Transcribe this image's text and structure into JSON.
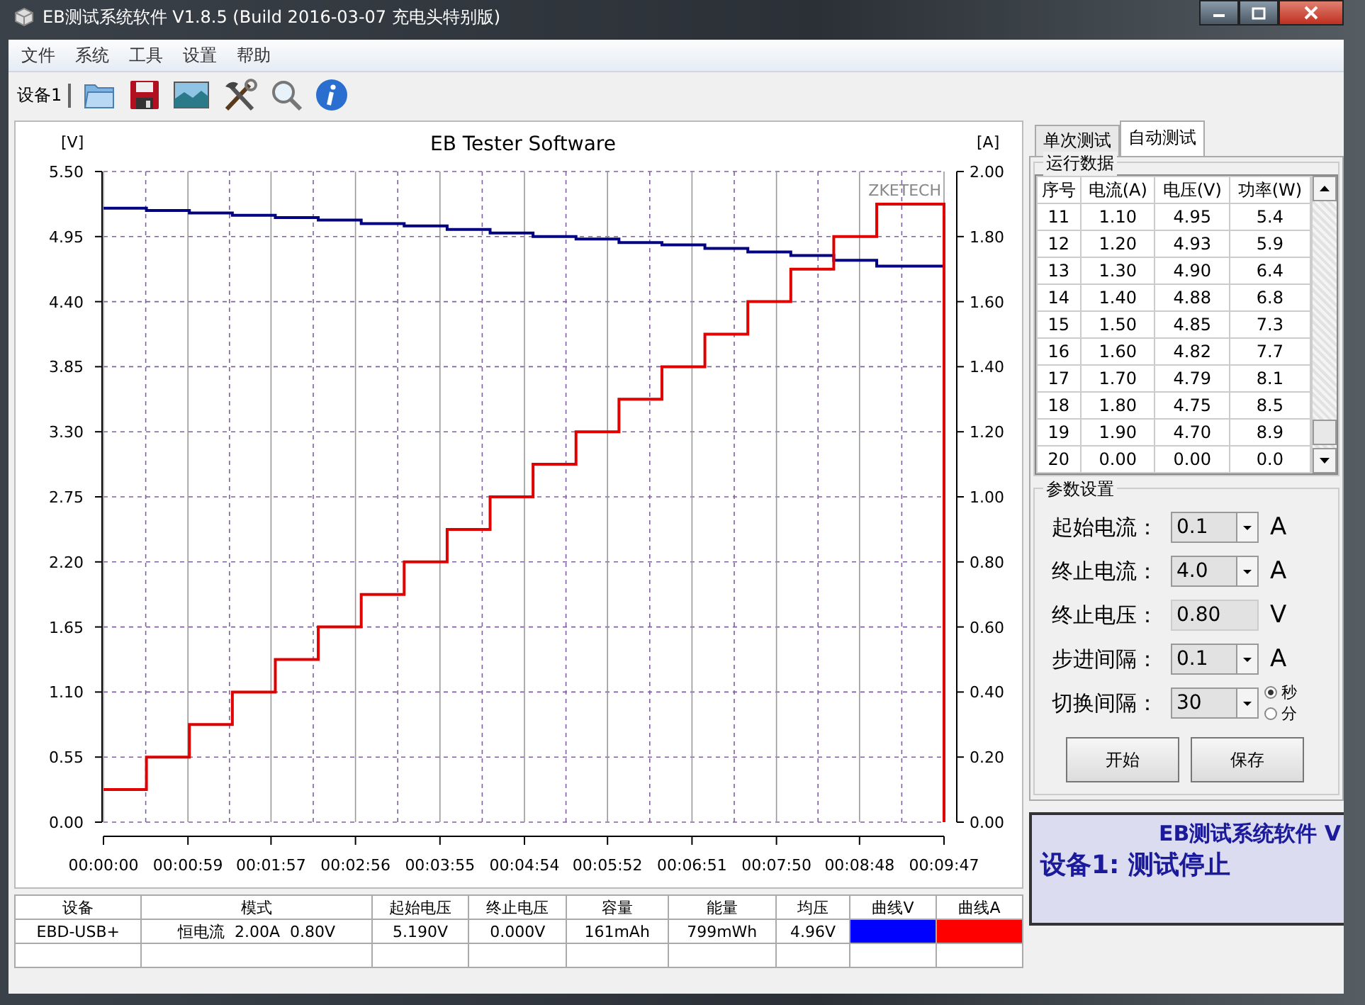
{
  "window": {
    "title": "EB测试系统软件 V1.8.5 (Build 2016-03-07 充电头特别版)"
  },
  "menu": [
    "文件",
    "系统",
    "工具",
    "设置",
    "帮助"
  ],
  "toolbar": {
    "device_tab": "设备1"
  },
  "chart": {
    "brand": "ZKETECH",
    "chart_data": {
      "type": "line",
      "title": "EB Tester Software",
      "ylabel": "[V]",
      "y2label": "[A]",
      "grid": true,
      "x": [
        0,
        30,
        30,
        60,
        60,
        90,
        90,
        120,
        120,
        150,
        150,
        180,
        180,
        210,
        210,
        240,
        240,
        270,
        270,
        300,
        300,
        330,
        330,
        360,
        360,
        390,
        390,
        420,
        420,
        450,
        450,
        480,
        480,
        510,
        510,
        540,
        540,
        587,
        587
      ],
      "series": [
        {
          "color": "#000080",
          "axis": "y",
          "values": [
            5.19,
            5.19,
            5.17,
            5.17,
            5.15,
            5.15,
            5.13,
            5.13,
            5.11,
            5.11,
            5.09,
            5.09,
            5.06,
            5.06,
            5.04,
            5.04,
            5.01,
            5.01,
            4.98,
            4.98,
            4.95,
            4.95,
            4.93,
            4.93,
            4.9,
            4.9,
            4.88,
            4.88,
            4.85,
            4.85,
            4.82,
            4.82,
            4.79,
            4.79,
            4.75,
            4.75,
            4.7,
            4.7,
            4.7
          ]
        },
        {
          "color": "#e00000",
          "axis": "y2",
          "values": [
            0.1,
            0.1,
            0.2,
            0.2,
            0.3,
            0.3,
            0.4,
            0.4,
            0.5,
            0.5,
            0.6,
            0.6,
            0.7,
            0.7,
            0.8,
            0.8,
            0.9,
            0.9,
            1.0,
            1.0,
            1.1,
            1.1,
            1.2,
            1.2,
            1.3,
            1.3,
            1.4,
            1.4,
            1.5,
            1.5,
            1.6,
            1.6,
            1.7,
            1.7,
            1.8,
            1.8,
            1.9,
            1.9,
            0
          ]
        }
      ],
      "xlim": [
        0,
        587
      ],
      "ylim": [
        0,
        5.5
      ],
      "y2lim": [
        0,
        2
      ],
      "xticks": [
        {
          "value": 0,
          "label": "00:00:00"
        },
        {
          "value": 59,
          "label": "00:00:59"
        },
        {
          "value": 117,
          "label": "00:01:57"
        },
        {
          "value": 176,
          "label": "00:02:56"
        },
        {
          "value": 235,
          "label": "00:03:55"
        },
        {
          "value": 294,
          "label": "00:04:54"
        },
        {
          "value": 352,
          "label": "00:05:52"
        },
        {
          "value": 411,
          "label": "00:06:51"
        },
        {
          "value": 470,
          "label": "00:07:50"
        },
        {
          "value": 528,
          "label": "00:08:48"
        },
        {
          "value": 587,
          "label": "00:09:47"
        }
      ],
      "yticks": [
        {
          "value": 0,
          "label": "0.00"
        },
        {
          "value": 0.55,
          "label": "0.55"
        },
        {
          "value": 1.1,
          "label": "1.10"
        },
        {
          "value": 1.65,
          "label": "1.65"
        },
        {
          "value": 2.2,
          "label": "2.20"
        },
        {
          "value": 2.75,
          "label": "2.75"
        },
        {
          "value": 3.3,
          "label": "3.30"
        },
        {
          "value": 3.85,
          "label": "3.85"
        },
        {
          "value": 4.4,
          "label": "4.40"
        },
        {
          "value": 4.95,
          "label": "4.95"
        },
        {
          "value": 5.5,
          "label": "5.50"
        }
      ],
      "y2ticks": [
        {
          "value": 0,
          "label": "0.00"
        },
        {
          "value": 0.2,
          "label": "0.20"
        },
        {
          "value": 0.4,
          "label": "0.40"
        },
        {
          "value": 0.6,
          "label": "0.60"
        },
        {
          "value": 0.8,
          "label": "0.80"
        },
        {
          "value": 1.0,
          "label": "1.00"
        },
        {
          "value": 1.2,
          "label": "1.20"
        },
        {
          "value": 1.4,
          "label": "1.40"
        },
        {
          "value": 1.6,
          "label": "1.60"
        },
        {
          "value": 1.8,
          "label": "1.80"
        },
        {
          "value": 2.0,
          "label": "2.00"
        }
      ]
    }
  },
  "summary_table": {
    "columns": [
      "设备",
      "模式",
      "起始电压",
      "终止电压",
      "容量",
      "能量",
      "均压",
      "曲线V",
      "曲线A"
    ],
    "rows": [
      {
        "cells": [
          "EBD-USB+",
          "恒电流  2.00A  0.80V",
          "5.190V",
          "0.000V",
          "161mAh",
          "799mWh",
          "4.96V"
        ],
        "curves": [
          {
            "color": "#0000ff"
          },
          {
            "color": "#ff0000"
          }
        ]
      }
    ]
  },
  "tabs": [
    {
      "label": "单次测试",
      "selected": false
    },
    {
      "label": "自动测试",
      "selected": true
    }
  ],
  "run_data": {
    "title": "运行数据",
    "columns": [
      "序号",
      "电流(A)",
      "电压(V)",
      "功率(W)"
    ],
    "rows": [
      [
        "11",
        "1.10",
        "4.95",
        "5.4"
      ],
      [
        "12",
        "1.20",
        "4.93",
        "5.9"
      ],
      [
        "13",
        "1.30",
        "4.90",
        "6.4"
      ],
      [
        "14",
        "1.40",
        "4.88",
        "6.8"
      ],
      [
        "15",
        "1.50",
        "4.85",
        "7.3"
      ],
      [
        "16",
        "1.60",
        "4.82",
        "7.7"
      ],
      [
        "17",
        "1.70",
        "4.79",
        "8.1"
      ],
      [
        "18",
        "1.80",
        "4.75",
        "8.5"
      ],
      [
        "19",
        "1.90",
        "4.70",
        "8.9"
      ],
      [
        "20",
        "0.00",
        "0.00",
        "0.0"
      ]
    ]
  },
  "params": {
    "title": "参数设置",
    "fields": [
      {
        "kind": "dropdown",
        "label": "起始电流：",
        "value": "0.1",
        "unit": "A"
      },
      {
        "kind": "dropdown",
        "label": "终止电流：",
        "value": "4.0",
        "unit": "A"
      },
      {
        "kind": "text",
        "label": "终止电压：",
        "value": "0.80",
        "unit": "V"
      },
      {
        "kind": "dropdown",
        "label": "步进间隔：",
        "value": "0.1",
        "unit": "A"
      },
      {
        "kind": "dropdown",
        "label": "切换间隔：",
        "value": "30",
        "units": [
          {
            "label": "秒",
            "selected": true
          },
          {
            "label": "分",
            "selected": false
          }
        ]
      }
    ],
    "buttons": [
      "开始",
      "保存"
    ]
  },
  "status": {
    "line_1": "EB测试系统软件 V",
    "line_2": "设备1: 测试停止"
  }
}
